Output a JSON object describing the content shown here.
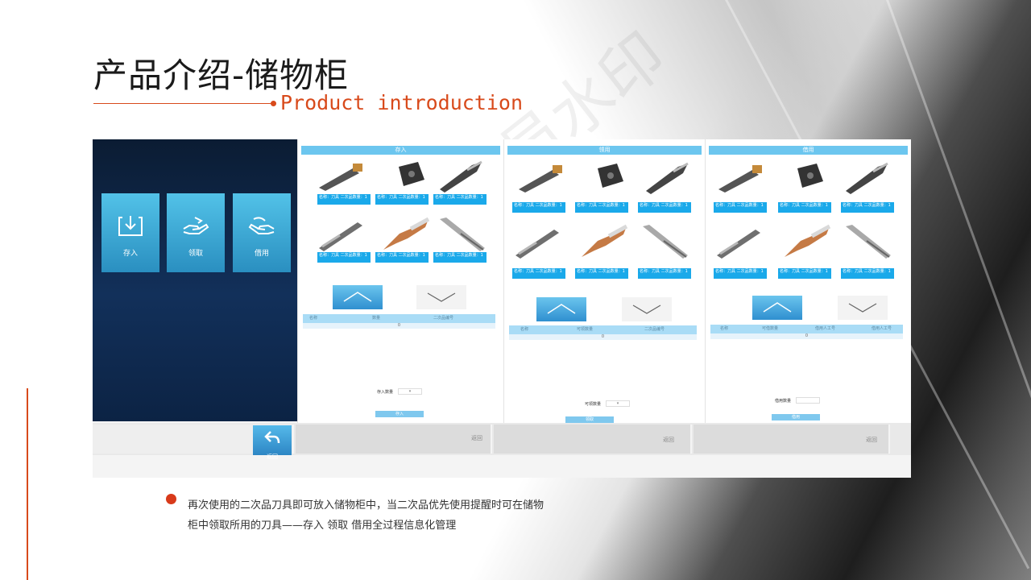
{
  "slide": {
    "title": "产品介绍-储物柜",
    "subtitle": "Product introduction",
    "accent_color": "#d84a1b",
    "watermark": "非会员水印"
  },
  "home_screen": {
    "tiles": [
      {
        "label": "存入",
        "icon": "deposit-icon"
      },
      {
        "label": "领取",
        "icon": "receive-hand-icon"
      },
      {
        "label": "借用",
        "icon": "borrow-hand-icon"
      }
    ],
    "back_label": "返回"
  },
  "screens": [
    {
      "header": "存入",
      "tools": [
        "holder-tool",
        "insert-tool",
        "drill-tool",
        "endmill-tool",
        "twist-drill-tool",
        "reamer-tool"
      ],
      "tool_label": "名称：刀具 二次品数量：1",
      "columns": [
        "名称",
        "数量",
        "二次品编号"
      ],
      "row_marker": "0",
      "qty_label": "存入数量",
      "confirm": "存入",
      "back_label": "返回"
    },
    {
      "header": "领用",
      "tools": [
        "holder-tool",
        "insert-tool",
        "drill-tool",
        "endmill-tool",
        "twist-drill-tool",
        "reamer-tool"
      ],
      "tool_label": "名称：刀具 二次品数量：1",
      "columns": [
        "名称",
        "可领数量",
        "二次品编号"
      ],
      "row_marker": "0",
      "qty_label": "可领数量",
      "confirm": "领取",
      "back_label": "返回"
    },
    {
      "header": "借用",
      "tools": [
        "holder-tool",
        "insert-tool",
        "drill-tool",
        "endmill-tool",
        "twist-drill-tool",
        "reamer-tool"
      ],
      "tool_label": "名称：刀具 二次品数量：1",
      "columns": [
        "名称",
        "可借数量",
        "借用人工号",
        "借用人工号"
      ],
      "row_marker": "0",
      "qty_label": "借用数量",
      "confirm": "借用",
      "back_label": "返回"
    }
  ],
  "description": {
    "line1": "再次使用的二次品刀具即可放入储物柜中，当二次品优先使用提醒时可在储物",
    "line2": "柜中领取所用的刀具——存入 领取 借用全过程信息化管理"
  }
}
